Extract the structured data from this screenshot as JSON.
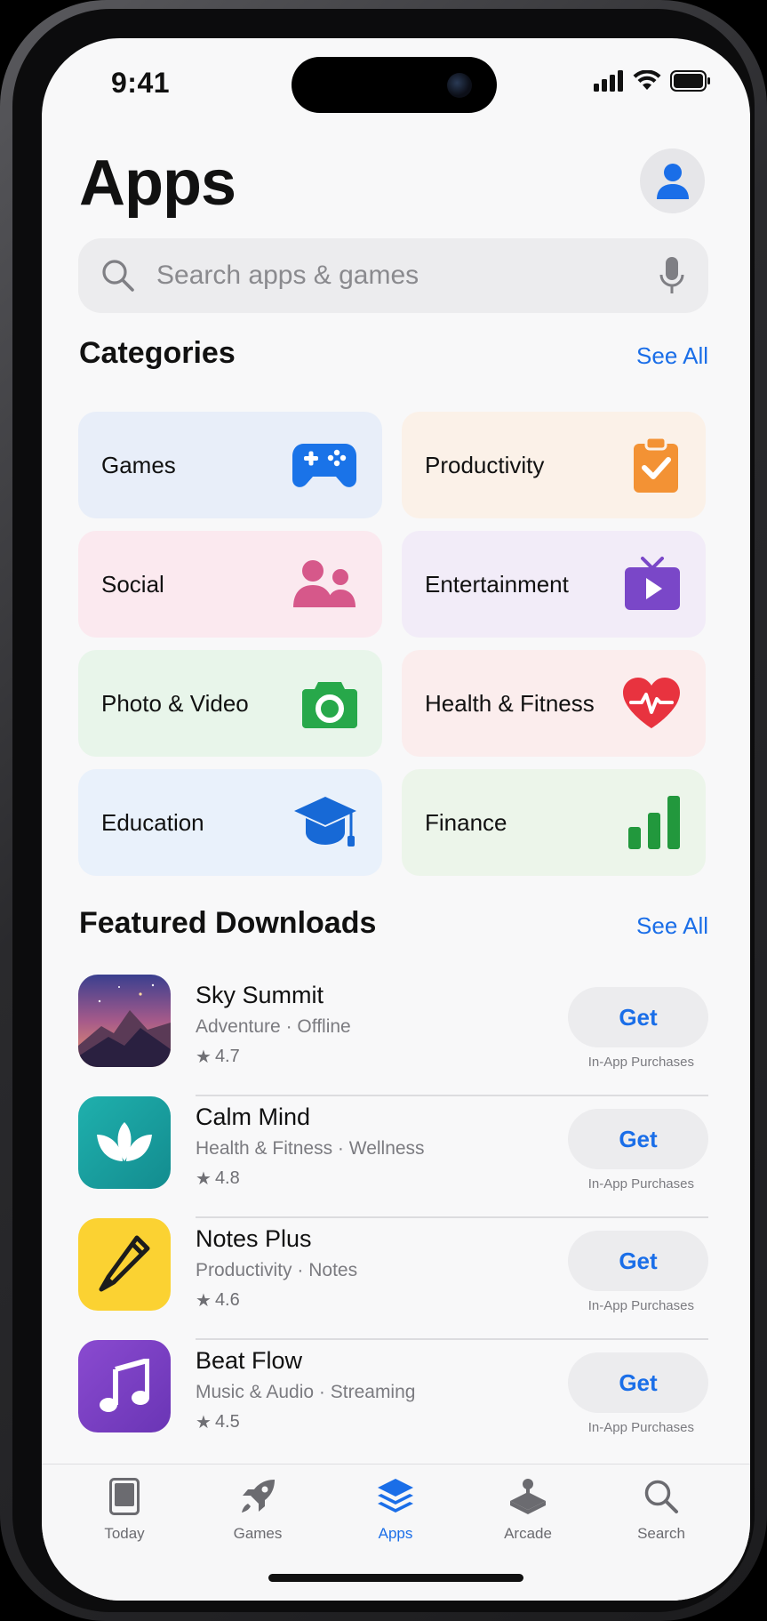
{
  "status": {
    "time": "9:41"
  },
  "header": {
    "title": "Apps"
  },
  "search": {
    "placeholder": "Search apps & games"
  },
  "categories": {
    "title": "Categories",
    "see_all": "See All",
    "items": [
      {
        "label": "Games",
        "icon": "gamepad-icon",
        "bg": "#e8eef9",
        "color": "#1a73e8"
      },
      {
        "label": "Productivity",
        "icon": "clipboard-check-icon",
        "bg": "#fbf1e8",
        "color": "#f39234"
      },
      {
        "label": "Social",
        "icon": "people-icon",
        "bg": "#fbe9ef",
        "color": "#d6588a"
      },
      {
        "label": "Entertainment",
        "icon": "tv-play-icon",
        "bg": "#f2ecf8",
        "color": "#7a47c8"
      },
      {
        "label": "Photo & Video",
        "icon": "camera-icon",
        "bg": "#e8f5ea",
        "color": "#27a84a"
      },
      {
        "label": "Health & Fitness",
        "icon": "heart-pulse-icon",
        "bg": "#fbeded",
        "color": "#e8333f"
      },
      {
        "label": "Education",
        "icon": "graduation-cap-icon",
        "bg": "#e9f1fb",
        "color": "#1769d6"
      },
      {
        "label": "Finance",
        "icon": "bar-chart-icon",
        "bg": "#ecf5ea",
        "color": "#22983d"
      }
    ]
  },
  "featured": {
    "title": "Featured Downloads",
    "see_all": "See All",
    "apps": [
      {
        "name": "Sky Summit",
        "category": "Adventure",
        "tag": "Offline",
        "rating": "4.7",
        "button": "Get",
        "note": "In-App Purchases",
        "icon": "mountain-icon"
      },
      {
        "name": "Calm Mind",
        "category": "Health & Fitness",
        "tag": "Wellness",
        "rating": "4.8",
        "button": "Get",
        "note": "In-App Purchases",
        "icon": "lotus-icon"
      },
      {
        "name": "Notes Plus",
        "category": "Productivity",
        "tag": "Notes",
        "rating": "4.6",
        "button": "Get",
        "note": "In-App Purchases",
        "icon": "pencil-icon"
      },
      {
        "name": "Beat Flow",
        "category": "Music & Audio",
        "tag": "Streaming",
        "rating": "4.5",
        "button": "Get",
        "note": "In-App Purchases",
        "icon": "music-note-icon"
      }
    ]
  },
  "tabbar": {
    "active": "Apps",
    "tabs": [
      {
        "label": "Today",
        "icon": "today-icon"
      },
      {
        "label": "Games",
        "icon": "rocket-icon"
      },
      {
        "label": "Apps",
        "icon": "layers-icon"
      },
      {
        "label": "Arcade",
        "icon": "joystick-icon"
      },
      {
        "label": "Search",
        "icon": "search-icon"
      }
    ]
  },
  "colors": {
    "accent": "#1a6ee8",
    "background": "#f8f8f9"
  }
}
